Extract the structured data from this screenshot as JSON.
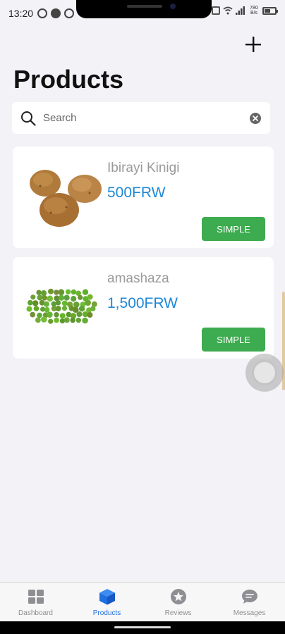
{
  "status_bar": {
    "time": "13:20",
    "net_rate_top": "780",
    "net_rate_bottom": "B/s",
    "battery_level": 0.6
  },
  "header": {
    "title": "Products",
    "add_icon": "plus-icon"
  },
  "search": {
    "placeholder": "Search",
    "value": "",
    "icon": "search-icon",
    "clear_icon": "clear-icon"
  },
  "products": [
    {
      "name": "Ibirayi Kinigi",
      "price": "500FRW",
      "type_label": "SIMPLE",
      "image": "potatoes-image"
    },
    {
      "name": "amashaza",
      "price": "1,500FRW",
      "type_label": "SIMPLE",
      "image": "green-peas-image"
    }
  ],
  "bottom_nav": {
    "active": "products",
    "items": [
      {
        "key": "dashboard",
        "label": "Dashboard",
        "icon": "dashboard-grid-icon"
      },
      {
        "key": "products",
        "label": "Products",
        "icon": "cube-icon"
      },
      {
        "key": "reviews",
        "label": "Reviews",
        "icon": "star-icon"
      },
      {
        "key": "messages",
        "label": "Messages",
        "icon": "chat-bubble-icon"
      }
    ]
  },
  "colors": {
    "background": "#f2f2f7",
    "price": "#1e88d6",
    "type_button": "#3dab4f",
    "active_tab": "#1f6fe0",
    "inactive_tab": "#8e8e93"
  }
}
